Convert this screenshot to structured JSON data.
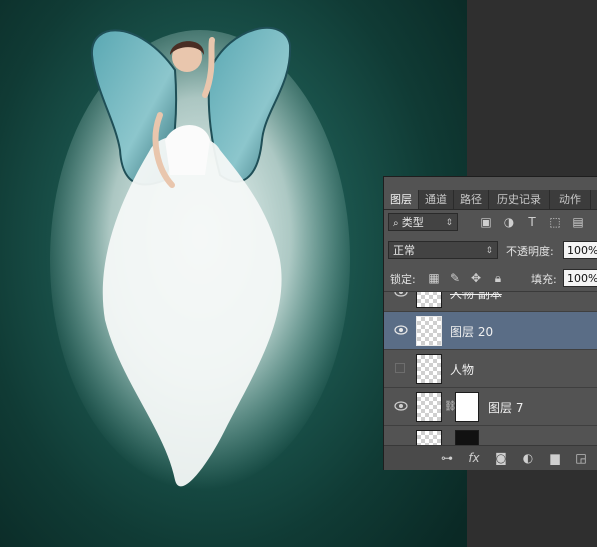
{
  "panel": {
    "tabs": [
      {
        "label": "图层",
        "active": true
      },
      {
        "label": "通道",
        "active": false
      },
      {
        "label": "路径",
        "active": false
      },
      {
        "label": "历史记录",
        "active": false
      },
      {
        "label": "动作",
        "active": false
      }
    ],
    "filter": {
      "icon": "search-icon",
      "label": "类型"
    },
    "blend_mode": "正常",
    "opacity_label": "不透明度:",
    "opacity_value": "100%",
    "lock_label": "锁定:",
    "fill_label": "填充:",
    "fill_value": "100%",
    "layers": [
      {
        "name": "人物 副本",
        "visible": true,
        "selected": false,
        "partial": true
      },
      {
        "name": "图层 20",
        "visible": true,
        "selected": true
      },
      {
        "name": "人物",
        "visible": false,
        "selected": false
      },
      {
        "name": "图层 7",
        "visible": true,
        "selected": false,
        "has_mask": true
      }
    ]
  },
  "colors": {
    "selected_layer": "#5a6d86",
    "panel_bg": "#535353",
    "canvas_teal": "#1d5a52"
  }
}
